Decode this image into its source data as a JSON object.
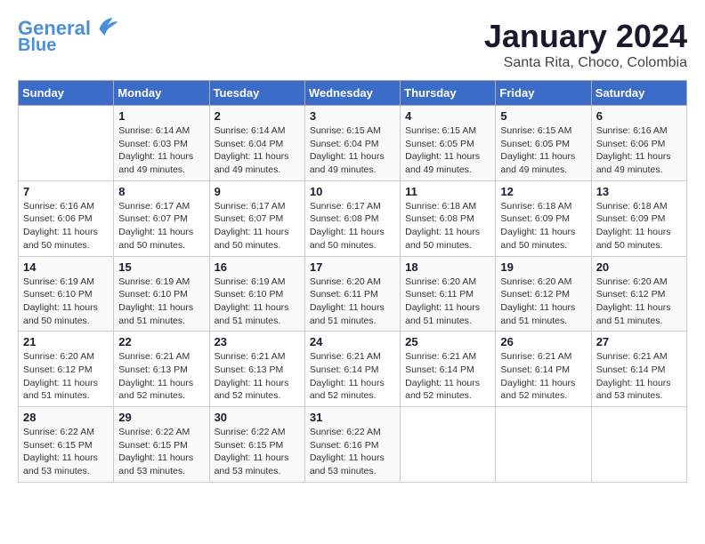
{
  "logo": {
    "line1": "General",
    "line2": "Blue"
  },
  "title": "January 2024",
  "subtitle": "Santa Rita, Choco, Colombia",
  "days_header": [
    "Sunday",
    "Monday",
    "Tuesday",
    "Wednesday",
    "Thursday",
    "Friday",
    "Saturday"
  ],
  "weeks": [
    [
      {
        "day": "",
        "info": ""
      },
      {
        "day": "1",
        "info": "Sunrise: 6:14 AM\nSunset: 6:03 PM\nDaylight: 11 hours\nand 49 minutes."
      },
      {
        "day": "2",
        "info": "Sunrise: 6:14 AM\nSunset: 6:04 PM\nDaylight: 11 hours\nand 49 minutes."
      },
      {
        "day": "3",
        "info": "Sunrise: 6:15 AM\nSunset: 6:04 PM\nDaylight: 11 hours\nand 49 minutes."
      },
      {
        "day": "4",
        "info": "Sunrise: 6:15 AM\nSunset: 6:05 PM\nDaylight: 11 hours\nand 49 minutes."
      },
      {
        "day": "5",
        "info": "Sunrise: 6:15 AM\nSunset: 6:05 PM\nDaylight: 11 hours\nand 49 minutes."
      },
      {
        "day": "6",
        "info": "Sunrise: 6:16 AM\nSunset: 6:06 PM\nDaylight: 11 hours\nand 49 minutes."
      }
    ],
    [
      {
        "day": "7",
        "info": "Sunrise: 6:16 AM\nSunset: 6:06 PM\nDaylight: 11 hours\nand 50 minutes."
      },
      {
        "day": "8",
        "info": "Sunrise: 6:17 AM\nSunset: 6:07 PM\nDaylight: 11 hours\nand 50 minutes."
      },
      {
        "day": "9",
        "info": "Sunrise: 6:17 AM\nSunset: 6:07 PM\nDaylight: 11 hours\nand 50 minutes."
      },
      {
        "day": "10",
        "info": "Sunrise: 6:17 AM\nSunset: 6:08 PM\nDaylight: 11 hours\nand 50 minutes."
      },
      {
        "day": "11",
        "info": "Sunrise: 6:18 AM\nSunset: 6:08 PM\nDaylight: 11 hours\nand 50 minutes."
      },
      {
        "day": "12",
        "info": "Sunrise: 6:18 AM\nSunset: 6:09 PM\nDaylight: 11 hours\nand 50 minutes."
      },
      {
        "day": "13",
        "info": "Sunrise: 6:18 AM\nSunset: 6:09 PM\nDaylight: 11 hours\nand 50 minutes."
      }
    ],
    [
      {
        "day": "14",
        "info": "Sunrise: 6:19 AM\nSunset: 6:10 PM\nDaylight: 11 hours\nand 50 minutes."
      },
      {
        "day": "15",
        "info": "Sunrise: 6:19 AM\nSunset: 6:10 PM\nDaylight: 11 hours\nand 51 minutes."
      },
      {
        "day": "16",
        "info": "Sunrise: 6:19 AM\nSunset: 6:10 PM\nDaylight: 11 hours\nand 51 minutes."
      },
      {
        "day": "17",
        "info": "Sunrise: 6:20 AM\nSunset: 6:11 PM\nDaylight: 11 hours\nand 51 minutes."
      },
      {
        "day": "18",
        "info": "Sunrise: 6:20 AM\nSunset: 6:11 PM\nDaylight: 11 hours\nand 51 minutes."
      },
      {
        "day": "19",
        "info": "Sunrise: 6:20 AM\nSunset: 6:12 PM\nDaylight: 11 hours\nand 51 minutes."
      },
      {
        "day": "20",
        "info": "Sunrise: 6:20 AM\nSunset: 6:12 PM\nDaylight: 11 hours\nand 51 minutes."
      }
    ],
    [
      {
        "day": "21",
        "info": "Sunrise: 6:20 AM\nSunset: 6:12 PM\nDaylight: 11 hours\nand 51 minutes."
      },
      {
        "day": "22",
        "info": "Sunrise: 6:21 AM\nSunset: 6:13 PM\nDaylight: 11 hours\nand 52 minutes."
      },
      {
        "day": "23",
        "info": "Sunrise: 6:21 AM\nSunset: 6:13 PM\nDaylight: 11 hours\nand 52 minutes."
      },
      {
        "day": "24",
        "info": "Sunrise: 6:21 AM\nSunset: 6:14 PM\nDaylight: 11 hours\nand 52 minutes."
      },
      {
        "day": "25",
        "info": "Sunrise: 6:21 AM\nSunset: 6:14 PM\nDaylight: 11 hours\nand 52 minutes."
      },
      {
        "day": "26",
        "info": "Sunrise: 6:21 AM\nSunset: 6:14 PM\nDaylight: 11 hours\nand 52 minutes."
      },
      {
        "day": "27",
        "info": "Sunrise: 6:21 AM\nSunset: 6:14 PM\nDaylight: 11 hours\nand 53 minutes."
      }
    ],
    [
      {
        "day": "28",
        "info": "Sunrise: 6:22 AM\nSunset: 6:15 PM\nDaylight: 11 hours\nand 53 minutes."
      },
      {
        "day": "29",
        "info": "Sunrise: 6:22 AM\nSunset: 6:15 PM\nDaylight: 11 hours\nand 53 minutes."
      },
      {
        "day": "30",
        "info": "Sunrise: 6:22 AM\nSunset: 6:15 PM\nDaylight: 11 hours\nand 53 minutes."
      },
      {
        "day": "31",
        "info": "Sunrise: 6:22 AM\nSunset: 6:16 PM\nDaylight: 11 hours\nand 53 minutes."
      },
      {
        "day": "",
        "info": ""
      },
      {
        "day": "",
        "info": ""
      },
      {
        "day": "",
        "info": ""
      }
    ]
  ]
}
